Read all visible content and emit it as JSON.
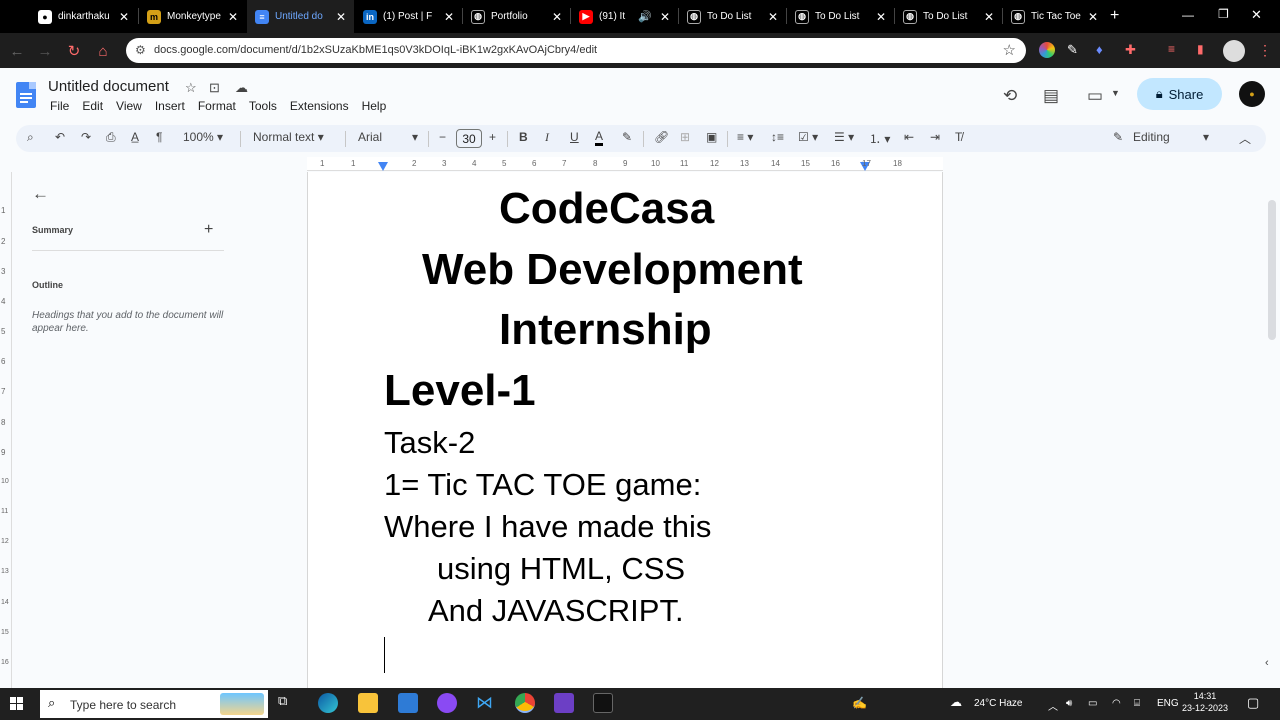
{
  "tabs": [
    {
      "title": "dinkarthaku",
      "icon": "github-icon",
      "active": false
    },
    {
      "title": "Monkeytype",
      "icon": "monkeytype-icon",
      "active": false
    },
    {
      "title": "Untitled do",
      "icon": "google-docs-icon",
      "active": true
    },
    {
      "title": "(1) Post | F",
      "icon": "linkedin-icon",
      "active": false
    },
    {
      "title": "Portfolio",
      "icon": "globe-icon",
      "active": false
    },
    {
      "title": "(91) It",
      "icon": "youtube-icon",
      "active": false
    },
    {
      "title": "To Do List",
      "icon": "globe-icon",
      "active": false
    },
    {
      "title": "To Do List",
      "icon": "globe-icon",
      "active": false
    },
    {
      "title": "To Do List",
      "icon": "globe-icon",
      "active": false
    },
    {
      "title": "Tic Tac Toe",
      "icon": "globe-icon",
      "active": false
    }
  ],
  "address_bar": {
    "url": "docs.google.com/document/d/1b2xSUzaKbME1qs0V3kDOIqL-iBK1w2gxKAvOAjCbry4/edit"
  },
  "doc": {
    "title": "Untitled document",
    "share_label": "Share",
    "menu": [
      "File",
      "Edit",
      "View",
      "Insert",
      "Format",
      "Tools",
      "Extensions",
      "Help"
    ],
    "toolbar": {
      "zoom": "100%",
      "style": "Normal text",
      "font": "Arial",
      "font_size": "30",
      "mode": "Editing"
    },
    "ruler": [
      "1",
      "1",
      "2",
      "3",
      "4",
      "5",
      "6",
      "7",
      "8",
      "9",
      "10",
      "11",
      "12",
      "13",
      "14",
      "15",
      "16",
      "17",
      "18"
    ],
    "vruler": [
      "1",
      "2",
      "3",
      "4",
      "5",
      "6",
      "7",
      "8",
      "9",
      "10",
      "11",
      "12",
      "13",
      "14",
      "15",
      "16"
    ]
  },
  "outline_panel": {
    "summary_label": "Summary",
    "outline_label": "Outline",
    "hint": "Headings that you add to the document will appear here."
  },
  "document_lines": [
    {
      "text": "CodeCasa",
      "style": "big"
    },
    {
      "text": "Web Development",
      "style": "big"
    },
    {
      "text": "Internship",
      "style": "big"
    },
    {
      "text": "Level-1",
      "style": "big"
    },
    {
      "text": "Task-2",
      "style": "normal"
    },
    {
      "text": "1= Tic TAC TOE game:",
      "style": "normal"
    },
    {
      "text": "Where I  have made this",
      "style": "normal"
    },
    {
      "text": "using HTML, CSS",
      "style": "normal"
    },
    {
      "text": "And  JAVASCRIPT.",
      "style": "normal"
    }
  ],
  "taskbar": {
    "search_placeholder": "Type here to search",
    "weather": "24°C  Haze",
    "language": "ENG",
    "time": "14:31",
    "date": "23-12-2023"
  },
  "colors": {
    "docs_blue": "#4285f4",
    "share_bg": "#c2e7ff",
    "active_tab_text": "#6ea8ff",
    "taskbar_bg": "#202020"
  }
}
